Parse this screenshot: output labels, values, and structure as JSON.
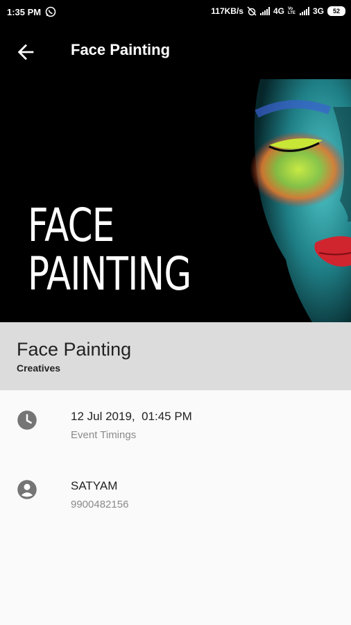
{
  "status_bar": {
    "time": "1:35 PM",
    "net_speed": "117KB/s",
    "network_1": "4G",
    "volte": "Vo LTE",
    "network_2": "3G",
    "battery": "52"
  },
  "app_bar": {
    "title": "Face Painting"
  },
  "hero": {
    "text_line1": "FACE",
    "text_line2": "PAINTING"
  },
  "event": {
    "name": "Face Painting",
    "category": "Creatives",
    "datetime": "12 Jul 2019,  01:45 PM",
    "datetime_caption": "Event Timings",
    "contact_name": "SATYAM",
    "contact_phone": "9900482156"
  },
  "colors": {
    "app_bar_bg": "#000000",
    "header_bg": "#dcdcdc",
    "icon_gray": "#757575"
  }
}
